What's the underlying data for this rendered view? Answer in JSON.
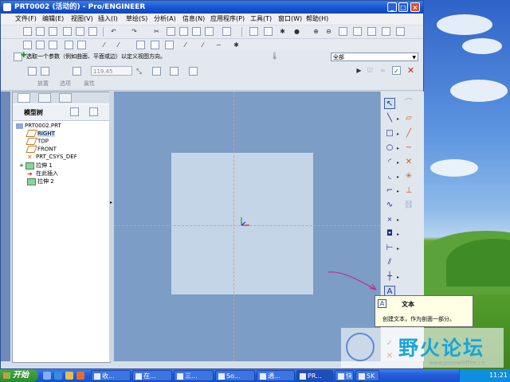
{
  "window": {
    "title": "PRT0002 (活动的) - Pro/ENGINEER",
    "controls": {
      "minimize": "_",
      "maximize": "□",
      "close": "×"
    }
  },
  "menu": {
    "items": [
      "文件(F)",
      "编辑(E)",
      "视图(V)",
      "插入(I)",
      "草绘(S)",
      "分析(A)",
      "信息(N)",
      "应用程序(P)",
      "工具(T)",
      "窗口(W)",
      "帮助(H)"
    ]
  },
  "dashboard": {
    "prompt": "选取一个参数（例如曲面、平面或边）以定义视图方向。",
    "filter": {
      "value": "全部"
    },
    "value_box": "119.45",
    "tabs": [
      "放置",
      "选项",
      "属性"
    ]
  },
  "model_tree": {
    "title": "模型树",
    "nodes": [
      {
        "label": "PRT0002.PRT",
        "icon": "part-icon",
        "indent": 0,
        "selected": false
      },
      {
        "label": "RIGHT",
        "icon": "datum-plane-icon",
        "indent": 1,
        "selected": true
      },
      {
        "label": "TOP",
        "icon": "datum-plane-icon",
        "indent": 1,
        "selected": false
      },
      {
        "label": "FRONT",
        "icon": "datum-plane-icon",
        "indent": 1,
        "selected": false
      },
      {
        "label": "PRT_CSYS_DEF",
        "icon": "csys-icon",
        "indent": 1,
        "selected": false
      },
      {
        "label": "拉伸 1",
        "icon": "extrude-icon",
        "indent": 1,
        "selected": false,
        "expandable": true
      },
      {
        "label": "在此插入",
        "icon": "insert-here-icon",
        "indent": 1,
        "selected": false
      },
      {
        "label": "拉伸 2",
        "icon": "extrude-icon",
        "indent": 1,
        "selected": false
      }
    ]
  },
  "tooltip": {
    "title": "文本",
    "description": "创建文本，作为剖面一部分。"
  },
  "watermark": {
    "text": "野火论坛",
    "url": "www.proewildfire.cn"
  },
  "taskbar": {
    "start": "开始",
    "tasks": [
      "收...",
      "在...",
      "三...",
      "So...",
      "通...",
      "PR...",
      "快...",
      "SK"
    ],
    "clock": "11:21"
  },
  "colors": {
    "title_blue": "#1553d2",
    "canvas_bg": "#7b9dc6",
    "sketch_rect": "#c5d5e8",
    "datum_line": "#e7a14d",
    "tree_selected": "#c6d8ff"
  }
}
